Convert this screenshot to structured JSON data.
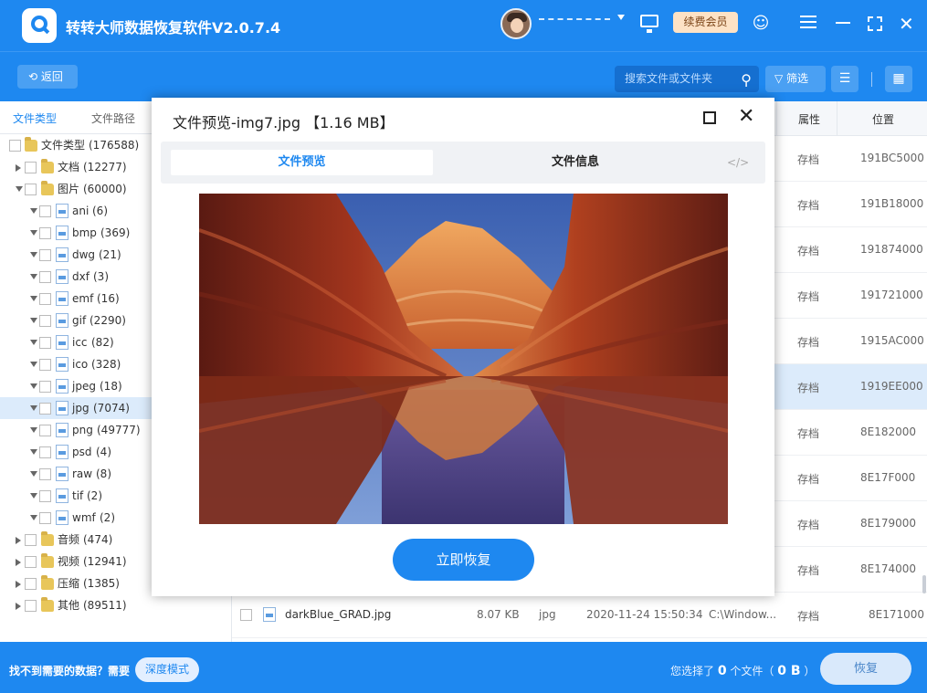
{
  "app": {
    "title": "转转大师数据恢复软件V2.0.7.4",
    "vip_label": "续费会员"
  },
  "toolbar": {
    "back_label": "返回",
    "search_placeholder": "搜索文件或文件夹",
    "filter_label": "筛选"
  },
  "sidebar": {
    "tabs": [
      "文件类型",
      "文件路径"
    ],
    "tree": [
      {
        "label": "文件类型",
        "count": "(176588)",
        "level": 0,
        "expanded": true,
        "icon": "folder"
      },
      {
        "label": "文档",
        "count": "(12277)",
        "level": 1,
        "expanded": false,
        "icon": "folder"
      },
      {
        "label": "图片",
        "count": "(60000)",
        "level": 1,
        "expanded": true,
        "icon": "folder"
      },
      {
        "label": "ani",
        "count": "(6)",
        "level": 2,
        "icon": "file"
      },
      {
        "label": "bmp",
        "count": "(369)",
        "level": 2,
        "icon": "file"
      },
      {
        "label": "dwg",
        "count": "(21)",
        "level": 2,
        "icon": "file"
      },
      {
        "label": "dxf",
        "count": "(3)",
        "level": 2,
        "icon": "file"
      },
      {
        "label": "emf",
        "count": "(16)",
        "level": 2,
        "icon": "file"
      },
      {
        "label": "gif",
        "count": "(2290)",
        "level": 2,
        "icon": "file"
      },
      {
        "label": "icc",
        "count": "(82)",
        "level": 2,
        "icon": "file"
      },
      {
        "label": "ico",
        "count": "(328)",
        "level": 2,
        "icon": "file"
      },
      {
        "label": "jpeg",
        "count": "(18)",
        "level": 2,
        "icon": "file"
      },
      {
        "label": "jpg",
        "count": "(7074)",
        "level": 2,
        "icon": "file",
        "selected": true
      },
      {
        "label": "png",
        "count": "(49777)",
        "level": 2,
        "icon": "file"
      },
      {
        "label": "psd",
        "count": "(4)",
        "level": 2,
        "icon": "file"
      },
      {
        "label": "raw",
        "count": "(8)",
        "level": 2,
        "icon": "file"
      },
      {
        "label": "tif",
        "count": "(2)",
        "level": 2,
        "icon": "file"
      },
      {
        "label": "wmf",
        "count": "(2)",
        "level": 2,
        "icon": "file"
      },
      {
        "label": "音频",
        "count": "(474)",
        "level": 1,
        "expanded": false,
        "icon": "folder"
      },
      {
        "label": "视频",
        "count": "(12941)",
        "level": 1,
        "expanded": false,
        "icon": "folder"
      },
      {
        "label": "压缩",
        "count": "(1385)",
        "level": 1,
        "expanded": false,
        "icon": "folder"
      },
      {
        "label": "其他",
        "count": "(89511)",
        "level": 1,
        "expanded": false,
        "icon": "folder"
      }
    ]
  },
  "table": {
    "headers": {
      "attr": "属性",
      "location": "位置"
    },
    "rows": [
      {
        "attr": "存档",
        "location": "191BC5000"
      },
      {
        "attr": "存档",
        "location": "191B18000"
      },
      {
        "attr": "存档",
        "location": "191874000"
      },
      {
        "attr": "存档",
        "location": "191721000"
      },
      {
        "attr": "存档",
        "location": "1915AC000"
      },
      {
        "attr": "存档",
        "location": "1919EE000",
        "selected": true
      },
      {
        "attr": "存档",
        "location": "8E182000"
      },
      {
        "attr": "存档",
        "location": "8E17F000"
      },
      {
        "attr": "存档",
        "location": "8E179000"
      },
      {
        "attr": "存档",
        "location": "8E174000"
      }
    ],
    "last_row": {
      "name": "darkBlue_GRAD.jpg",
      "size": "8.07 KB",
      "type": "jpg",
      "date": "2020-11-24 15:50:34",
      "path": "C:\\Window...",
      "attr": "存档",
      "location": "8E171000"
    }
  },
  "footer": {
    "hint": "找不到需要的数据？需要",
    "deep_mode_label": "深度模式",
    "selected_prefix": "您选择了",
    "selected_count": "0",
    "selected_unit": "个文件（",
    "selected_size": "0 B",
    "selected_suffix": "）",
    "recover_label": "恢复"
  },
  "modal": {
    "title": "文件预览-img7.jpg 【1.16 MB】",
    "tab_preview": "文件预览",
    "tab_info": "文件信息",
    "tab_code": "</>",
    "recover_label": "立即恢复"
  }
}
